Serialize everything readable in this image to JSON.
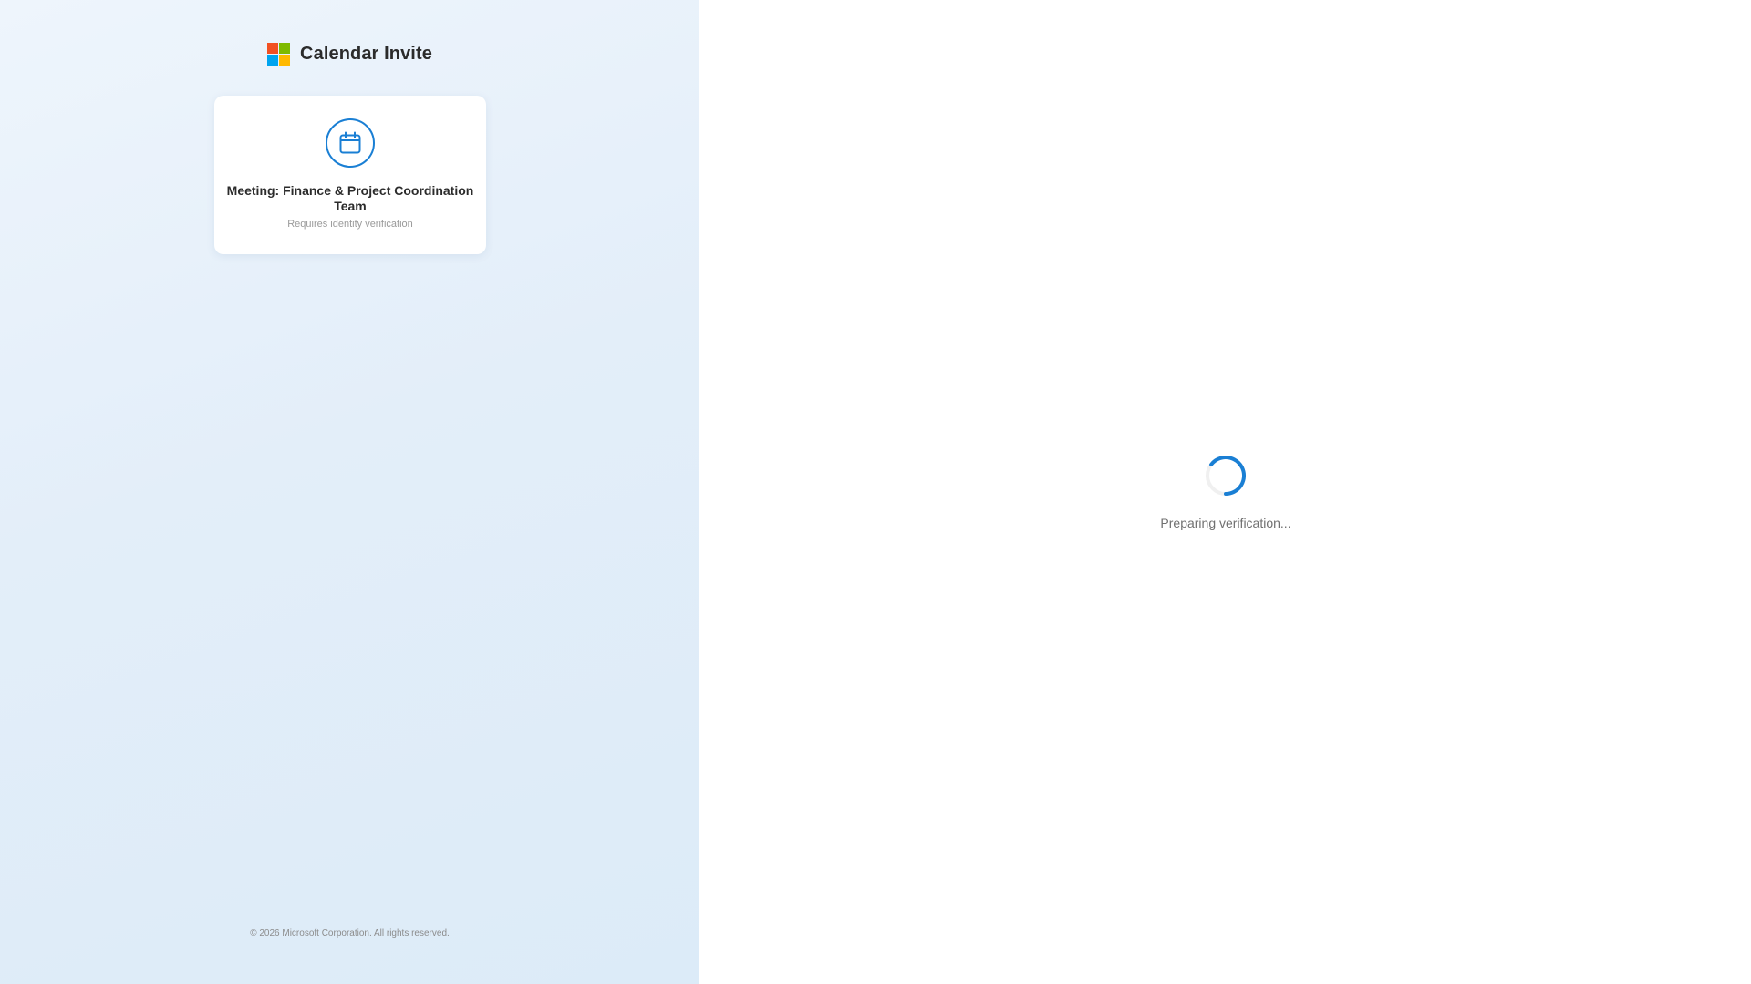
{
  "app": {
    "title": "Calendar Invite",
    "logo_colors": [
      "#f25022",
      "#7fba00",
      "#00a4ef",
      "#ffb900"
    ],
    "accent_color": "#1a7fd4"
  },
  "card": {
    "icon": "calendar-icon",
    "title": "Meeting: Finance & Project Coordination Team",
    "subtitle": "Requires identity verification"
  },
  "footer": {
    "copyright": "© 2026 Microsoft Corporation. All rights reserved."
  },
  "verification": {
    "icon": "loading-spinner-icon",
    "status": "Preparing verification..."
  }
}
